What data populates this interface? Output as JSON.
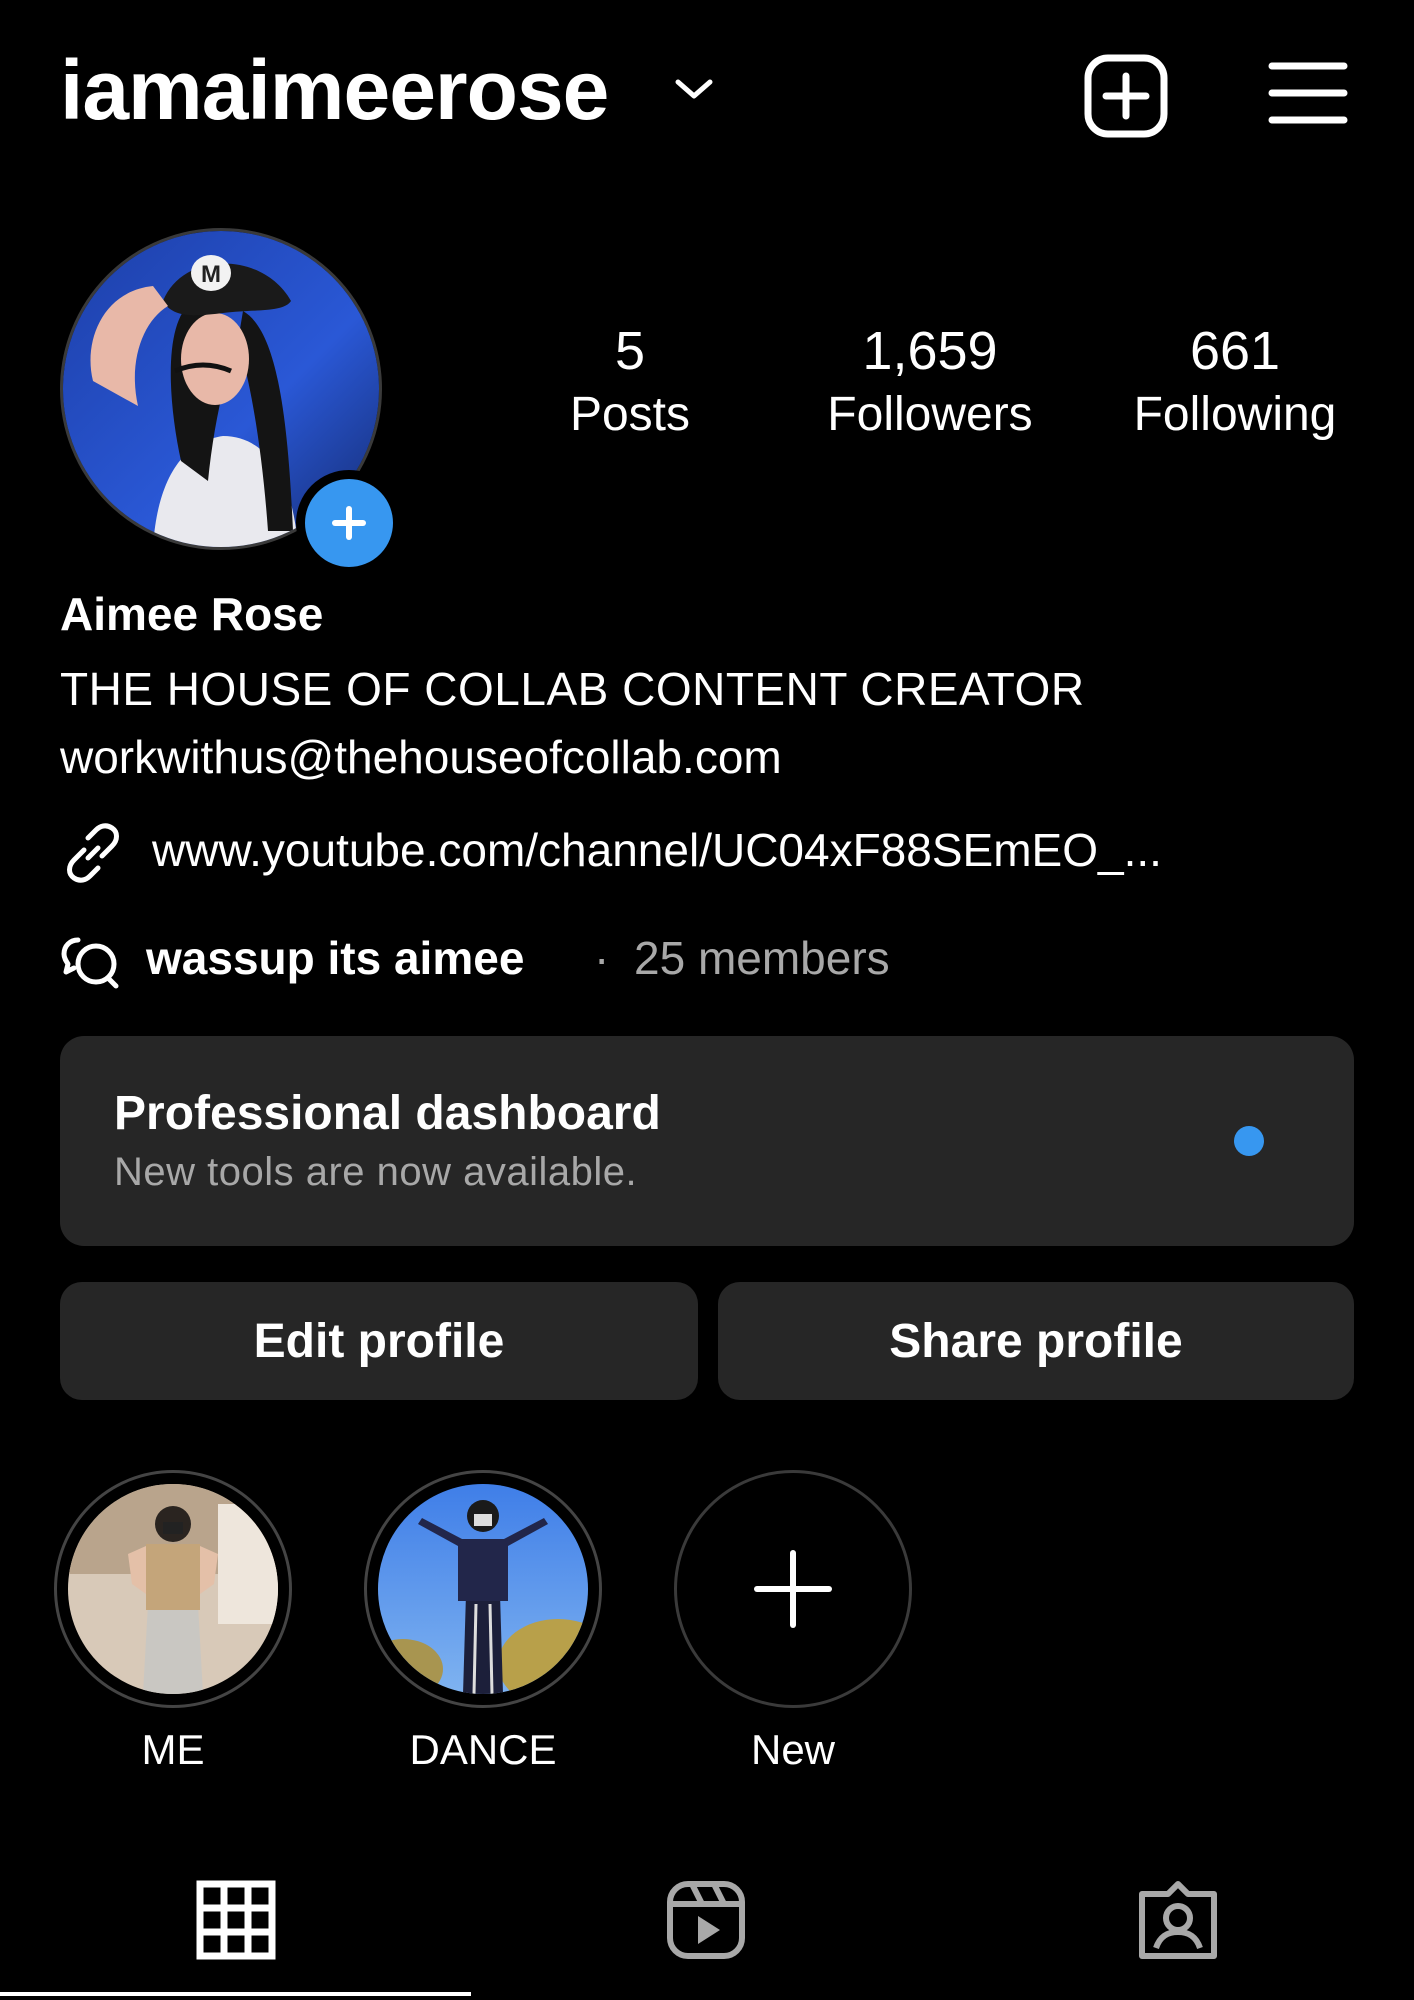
{
  "header": {
    "username": "iamaimeerose",
    "icons": [
      "chevron-down-icon",
      "new-post-icon",
      "menu-icon"
    ]
  },
  "profile": {
    "avatar_badge_icon": "plus-icon",
    "stats": [
      {
        "value": "5",
        "label": "Posts"
      },
      {
        "value": "1,659",
        "label": "Followers"
      },
      {
        "value": "661",
        "label": "Following"
      }
    ],
    "name": "Aimee Rose",
    "bio_line1": "THE HOUSE OF COLLAB CONTENT CREATOR",
    "bio_line2": "workwithus@thehouseofcollab.com",
    "link": "www.youtube.com/channel/UC04xF88SEmEO_...",
    "channel": {
      "name": "wassup its aimee",
      "separator": "·",
      "members": "25 members"
    }
  },
  "dashboard": {
    "title": "Professional dashboard",
    "subtitle": "New tools are now available.",
    "dot_color": "#3797f0"
  },
  "buttons": {
    "edit": "Edit profile",
    "share": "Share profile"
  },
  "highlights": [
    {
      "label": "ME"
    },
    {
      "label": "DANCE"
    },
    {
      "label": "New"
    }
  ],
  "tabs": [
    "grid-icon",
    "reels-icon",
    "tagged-icon"
  ],
  "colors": {
    "background": "#000000",
    "card": "#262626",
    "accent": "#3797f0",
    "muted_text": "#a8a8a8"
  }
}
